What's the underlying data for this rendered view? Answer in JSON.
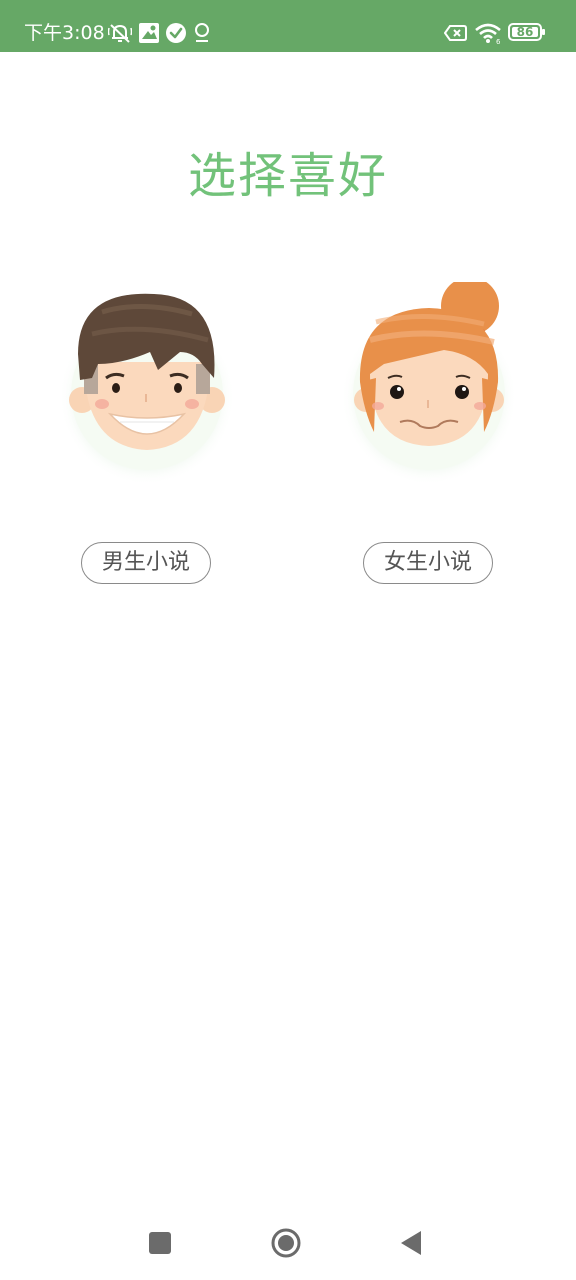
{
  "status_bar": {
    "time": "下午3:08",
    "battery_level": "86",
    "background_color": "#66a866",
    "icons": [
      "mute-icon",
      "kite-icon",
      "check-circle-icon",
      "location-pin-icon",
      "sim-off-icon",
      "wifi-icon",
      "battery-icon"
    ]
  },
  "page": {
    "title": "选择喜好",
    "title_color": "#72c27a"
  },
  "choices": {
    "boy": {
      "label": "男生小说",
      "avatar": "boy-avatar"
    },
    "girl": {
      "label": "女生小说",
      "avatar": "girl-avatar"
    }
  },
  "nav_bar": {
    "buttons": [
      "recents-button",
      "home-button",
      "back-button"
    ]
  }
}
